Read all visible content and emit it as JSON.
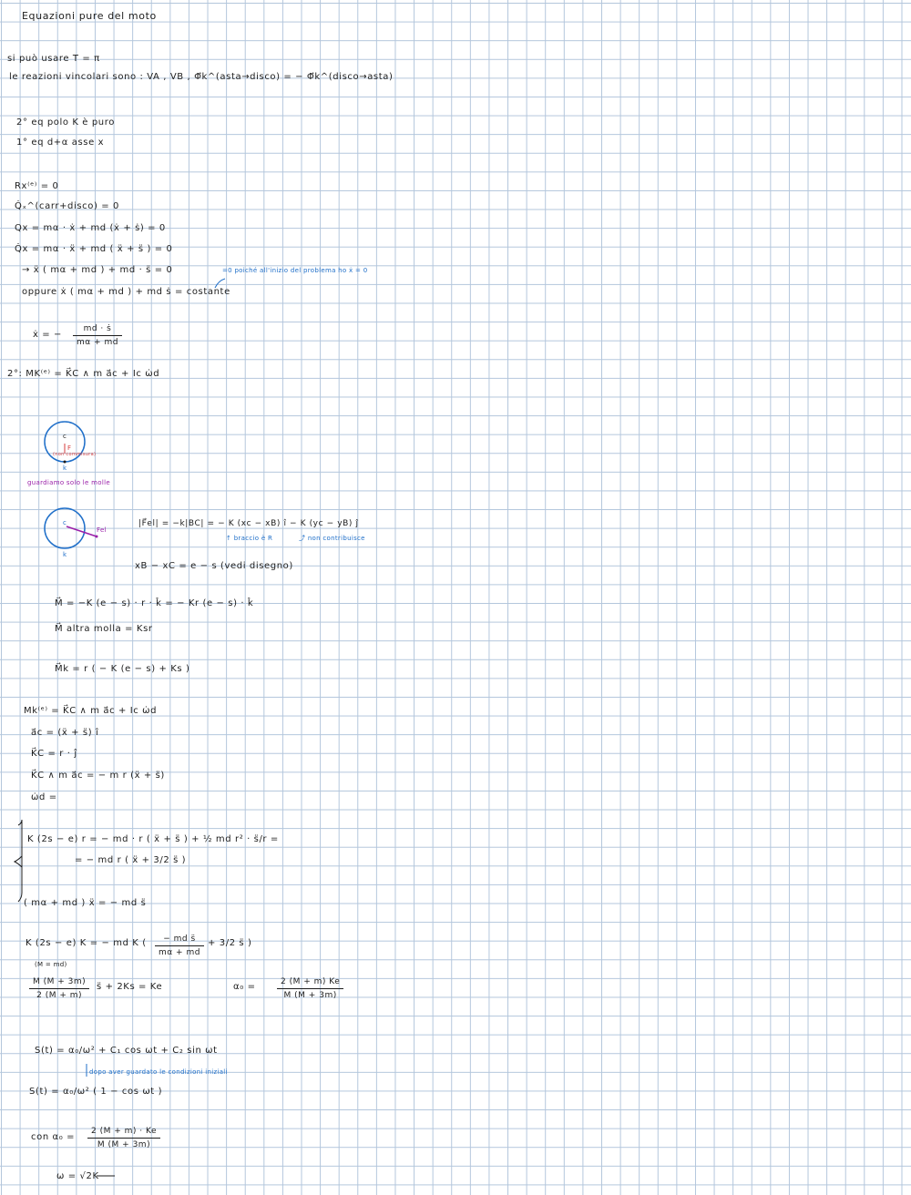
{
  "title": "Equazioni pure del moto",
  "lines": {
    "t_pi": "si può usare T = π",
    "reazioni": "le reazioni vincolari sono :   VA , VB ,   Φ⃗k^(asta→disco)  =  − Φ⃗k^(disco→asta)",
    "eq2": "2° eq  polo K  è puro",
    "eq1": "1° eq   d+α   asse  x",
    "rx": "Rx⁽ᵉ⁾  =  0",
    "qdot": "Q̇ₓ^(carr+disco)  = 0",
    "qx1": "Qx  =  mα · ẋ  +    md (ẋ + ṡ) = 0",
    "qx2": "Q̇x =  mα · ẍ  +  md ( ẍ + s̈ ) = 0",
    "arrow_eq": "→       ẍ ( mα + md ) + md · s̈ = 0",
    "note1": "=0 poiché all'inizio del problema    ho  ẋ = 0",
    "oppure": "oppure      ẋ ( mα + md ) + md ṡ =  costante",
    "xdot_lhs": "ẋ = −",
    "eq2nd": "2°:    MK⁽ᵉ⁾  =  K⃗C ∧ m a⃗c  +  Ic ω̇d",
    "circle1_c": "c",
    "circle1_f": "F",
    "circle1_k": "k",
    "circle1_note": "(non commisura)",
    "guardiamo": "guardiamo solo le molle",
    "circle2_c": "c",
    "circle2_fel": "Fel",
    "circle2_k": "k",
    "fel_eq": "|F⃗el| = −k|BC|  =  − K (xc − xB) î  − K (yc − yB) ĵ",
    "braccio": "↑ braccio è R",
    "non_contribuisce": "⤴ non contribuisce",
    "xb_xc": "xB − xC = e − s (vedi disegno)",
    "m_eq": "M⃗  =  −K (e − s) · r · k̂  =  − Kr (e − s) · k̂",
    "m_altra": "M⃗  altra  molla  =   Ksr",
    "mk_eq": "M⃗k  =  r ( − K (e − s) + Ks )",
    "mk2": "Mk⁽ᵉ⁾  =  K⃗C ∧ m a⃗c  +  Ic ω̇d",
    "ac": "a⃗c = (ẍ + s̈) î",
    "kc": "K⃗C = r · ĵ",
    "kc_cross": "K⃗C ∧ m a⃗c = − m r (ẍ + s̈)",
    "wd": "ω̇d =",
    "sys1": "K (2s − e) r  =  − md · r ( ẍ + s̈ )  + ½ md r² · s̈/r  =",
    "sys2": "=  − md r ( ẍ + 3/2 s̈ )",
    "sys3": "( mα + md ) ẍ  =  − md s̈",
    "final1_lhs": "K (2s − e) K  =  − md K (",
    "final1_num": "− md s̈",
    "final1_den": "mα + md",
    "final1_rhs": "+ 3/2 s̈ )",
    "m_eq_label": "(M = md)",
    "frac_a_num": "M (M + 3m)",
    "frac_a_den": "2 (M + m)",
    "ode_rest": "s̈  +  2Ks  =  Ke",
    "alpha0_lhs": "α₀ =",
    "alpha0_num": "2 (M + m)  Ke",
    "alpha0_den": "M (M + 3m)",
    "sol1": "S(t) =  α₀/ω²  +  C₁ cos ωt  +  C₂ sin ωt",
    "note2": "dopo aver guardato le condizioni iniziali",
    "sol2": "S(t) =  α₀/ω²  ( 1 − cos ωt )",
    "con_lhs": "con  α₀ =",
    "con_num": "2 (M + m) · Ke",
    "con_den": "M (M + 3m)",
    "omega": "ω  =  √2K"
  },
  "xdot_frac": {
    "num": "md · ṡ",
    "den": "mα + md"
  },
  "colors": {
    "grid": "#b3c6dc",
    "ink": "#1c1c1c",
    "blue": "#1f6fc9",
    "purple": "#9a1fa8",
    "red": "#d63b3b"
  }
}
